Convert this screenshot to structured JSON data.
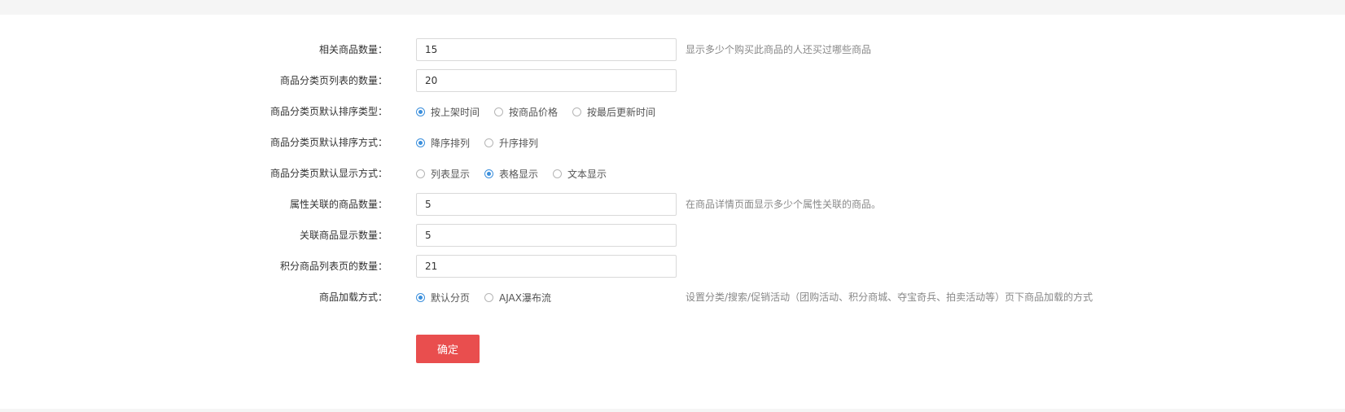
{
  "form": {
    "related_goods_count": {
      "label": "相关商品数量：",
      "value": "15",
      "hint": "显示多少个购买此商品的人还买过哪些商品"
    },
    "category_list_count": {
      "label": "商品分类页列表的数量：",
      "value": "20"
    },
    "category_default_sort_type": {
      "label": "商品分类页默认排序类型：",
      "options": [
        "按上架时间",
        "按商品价格",
        "按最后更新时间"
      ],
      "selected": "按上架时间"
    },
    "category_default_sort_order": {
      "label": "商品分类页默认排序方式：",
      "options": [
        "降序排列",
        "升序排列"
      ],
      "selected": "降序排列"
    },
    "category_default_display": {
      "label": "商品分类页默认显示方式：",
      "options": [
        "列表显示",
        "表格显示",
        "文本显示"
      ],
      "selected": "表格显示"
    },
    "attribute_related_count": {
      "label": "属性关联的商品数量：",
      "value": "5",
      "hint": "在商品详情页面显示多少个属性关联的商品。"
    },
    "related_display_count": {
      "label": "关联商品显示数量：",
      "value": "5"
    },
    "points_list_count": {
      "label": "积分商品列表页的数量：",
      "value": "21"
    },
    "loading_mode": {
      "label": "商品加载方式：",
      "options": [
        "默认分页",
        "AJAX瀑布流"
      ],
      "selected": "默认分页",
      "hint": "设置分类/搜索/促销活动（团购活动、积分商城、夺宝奇兵、拍卖活动等）页下商品加载的方式"
    },
    "submit_label": "确定"
  },
  "colors": {
    "accent": "#3b8fdc",
    "submit_bg": "#e94e4e"
  }
}
